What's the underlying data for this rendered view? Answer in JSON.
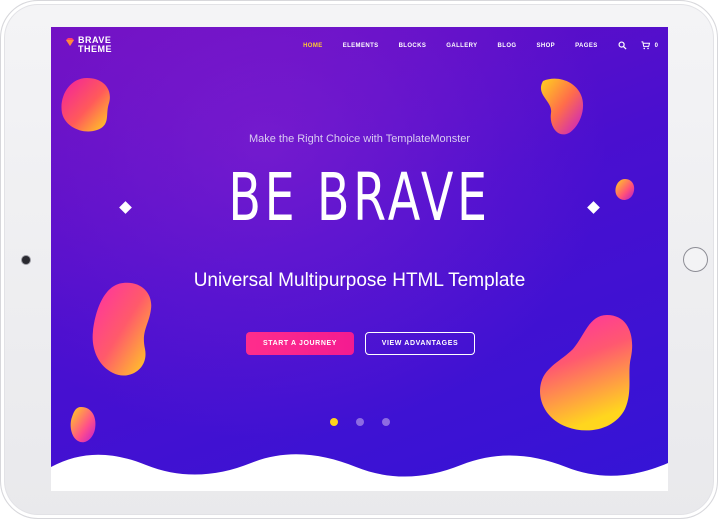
{
  "brand": {
    "line1": "BRAVE",
    "line2": "THEME"
  },
  "nav": {
    "items": [
      {
        "label": "HOME",
        "active": true
      },
      {
        "label": "ELEMENTS",
        "active": false
      },
      {
        "label": "BLOCKS",
        "active": false
      },
      {
        "label": "GALLERY",
        "active": false
      },
      {
        "label": "BLOG",
        "active": false
      },
      {
        "label": "SHOP",
        "active": false
      },
      {
        "label": "PAGES",
        "active": false
      }
    ],
    "search_icon": "search-icon",
    "cart_icon": "cart-icon",
    "cart_count": "0"
  },
  "hero": {
    "kicker": "Make the Right Choice with TemplateMonster",
    "title": "BE BRAVE",
    "subtitle": "Universal Multipurpose HTML Template",
    "primary_button": "START A JOURNEY",
    "secondary_button": "VIEW ADVANTAGES"
  },
  "slider": {
    "count": 3,
    "active_index": 0
  },
  "colors": {
    "accent_yellow": "#ffcc2f",
    "accent_pink": "#ff2d8c",
    "background_purple": "#4a0fcf"
  }
}
